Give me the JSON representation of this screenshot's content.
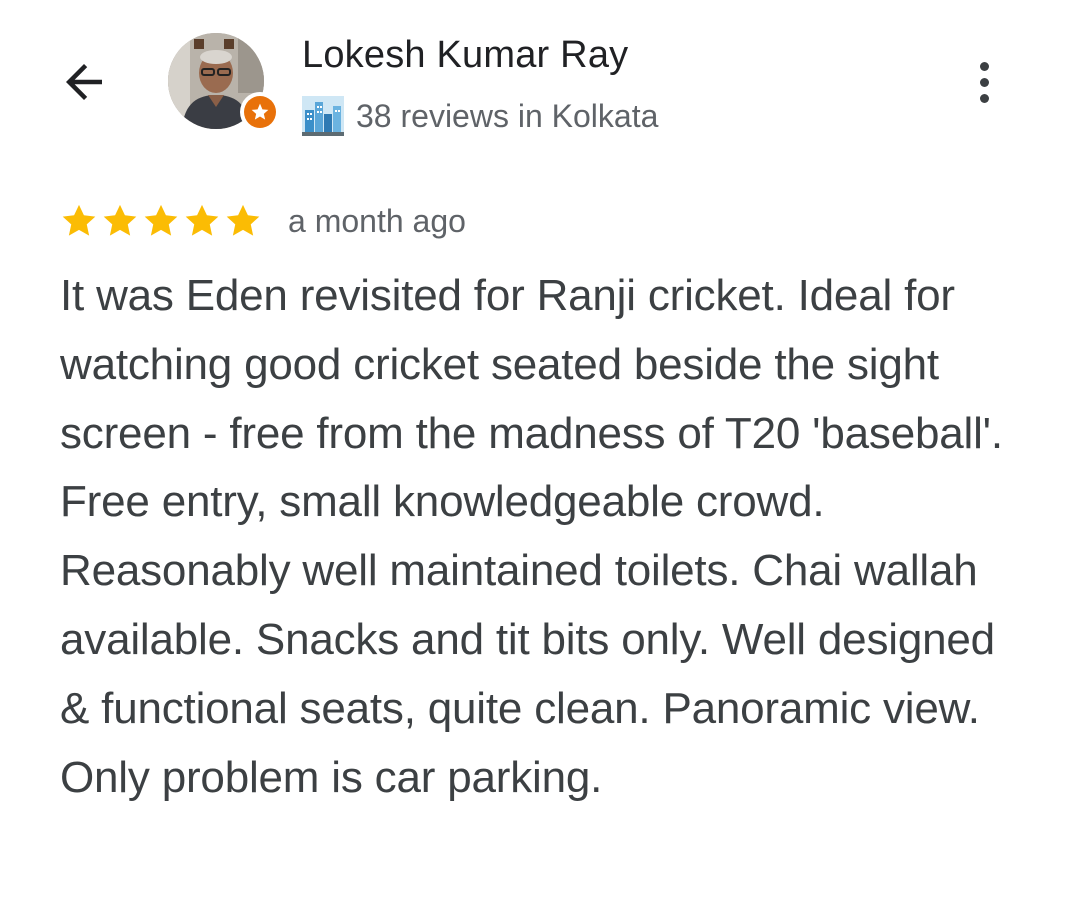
{
  "header": {
    "back_icon": "arrow-left-icon",
    "reviewer_name": "Lokesh Kumar Ray",
    "reviewer_meta": "38 reviews in Kolkata",
    "badge_icon": "local-guide-star-icon",
    "city_icon": "cityscape-icon",
    "more_icon": "more-vert-icon",
    "badge_color": "#e8710a"
  },
  "review": {
    "stars": 5,
    "star_color": "#fbbc04",
    "time": "a month ago",
    "text": "It was Eden revisited for Ranji cricket. Ideal for watching good cricket seated beside the sight screen - free from the madness of T20 'baseball'. Free entry, small knowledgeable crowd. Reasonably well maintained toilets. Chai wallah available. Snacks and tit bits only. Well designed & functional seats, quite clean. Panoramic view. Only problem is car parking."
  }
}
